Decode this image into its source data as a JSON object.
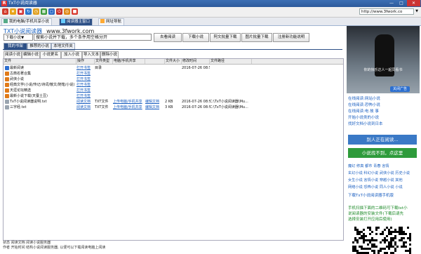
{
  "window": {
    "title": "TxT小说阅读器",
    "controls": {
      "minimize": "—",
      "maximize": "□",
      "close": "✕"
    }
  },
  "toolbar": {
    "icons": [
      {
        "name": "home-icon",
        "color": "#d23b2b",
        "glyph": "⌂"
      },
      {
        "name": "star-icon",
        "color": "#e8a317",
        "glyph": "★"
      },
      {
        "name": "bag-icon",
        "color": "#d4302f",
        "glyph": "▣"
      },
      {
        "name": "refresh-icon",
        "color": "#2f7ad0",
        "glyph": "↻"
      },
      {
        "name": "clock-icon",
        "color": "#e0a020",
        "glyph": "◷"
      },
      {
        "name": "grid-icon",
        "color": "#3a9a3a",
        "glyph": "▦"
      },
      {
        "name": "window-icon",
        "color": "#2c6bc6",
        "glyph": "▢"
      },
      {
        "name": "power-icon",
        "color": "#c8302b",
        "glyph": "⏻"
      },
      {
        "name": "disc-icon",
        "color": "#e08a18",
        "glyph": "◎"
      },
      {
        "name": "stop-icon",
        "color": "#d83a2e",
        "glyph": "■"
      }
    ],
    "address": "http://www.3fwork.co",
    "address_arrow": "▼"
  },
  "window_tabs": [
    {
      "label": "我的电脑/手机共享小说",
      "active": false
    },
    {
      "label": "阅读器主窗口",
      "active": true
    },
    {
      "label": "网址导航",
      "active": false
    }
  ],
  "header": {
    "brand": "TXT小说阅读器",
    "brand_url": "www.3fwork.com",
    "search_category": "下载小说▼",
    "search_text": "搜索小说并下载，多个条件用空格分开",
    "buttons": [
      "去看阅读",
      "下载小说",
      "阿文批量下载",
      "图片批量下载",
      "注册新功能说明"
    ]
  },
  "local_tabs": [
    {
      "label": "我的书架",
      "active": true
    },
    {
      "label": "推荐的小说",
      "active": false
    },
    {
      "label": "本地文件夹",
      "active": false
    }
  ],
  "sub_toolbar": [
    "阅读小说",
    "编辑小说",
    "小说更名",
    "加入小说",
    "导入文本",
    "删除小说"
  ],
  "table": {
    "columns": [
      "文件",
      "操作",
      "文件类型",
      "电脑/手机共享",
      "",
      "文件大小",
      "修改时间",
      "文件路径"
    ],
    "rows": [
      {
        "icon": "#2f6fd0",
        "name": "最新阅读",
        "action": "打开书签",
        "type": "目录",
        "share": "",
        "edit": "",
        "size": "",
        "time": "2016-07-26 08:50",
        "path": ""
      },
      {
        "icon": "#e07a1a",
        "name": "古典名著合集",
        "action": "打开书签",
        "type": "",
        "share": "",
        "edit": "",
        "size": "",
        "time": "",
        "path": ""
      },
      {
        "icon": "#e07a1a",
        "name": "武侠小说",
        "action": "打开书签",
        "type": "",
        "share": "",
        "edit": "",
        "size": "",
        "time": "",
        "path": ""
      },
      {
        "icon": "#e07a1a",
        "name": "经典文学(小说/传记/诗词/散文/随笔/小说)",
        "action": "打开书签",
        "type": "",
        "share": "",
        "edit": "",
        "size": "",
        "time": "",
        "path": ""
      },
      {
        "icon": "#e07a1a",
        "name": "天涯论坛精选",
        "action": "打开书签",
        "type": "",
        "share": "",
        "edit": "",
        "size": "",
        "time": "",
        "path": ""
      },
      {
        "icon": "#e07a1a",
        "name": "最新小说下载(天蚕土豆)",
        "action": "打开书签",
        "type": "",
        "share": "",
        "edit": "",
        "size": "",
        "time": "",
        "path": ""
      },
      {
        "icon": "#9aa4b0",
        "name": "TxT小说阅读器说明.txt",
        "action": "阅读文档",
        "type": "TXT文件",
        "share": "上传电脑/手机共享",
        "edit": "编辑文档",
        "size": "2 KB",
        "time": "2016-07-26 08:50",
        "path": "C:\\TxT小说阅读器\\Mu..."
      },
      {
        "icon": "#9aa4b0",
        "name": "三字经.txt",
        "action": "阅读文档",
        "type": "TXT文件",
        "share": "上传电脑/手机共享",
        "edit": "编辑文档",
        "size": "3 KB",
        "time": "2016-07-26 08:50",
        "path": "C:\\TxT小说阅读器\\Mu..."
      }
    ]
  },
  "status": {
    "line1": "状态 阅读文档 阅读小说服务器",
    "line2": "作者 开始时间 结构小说阅读服务器, 以便可以下载阅读电脑上阅读"
  },
  "right_panel": {
    "promo_text": "你的快乐达人一起同看书",
    "close_ad": "关闭广告",
    "links": [
      "在线阅读:网站小说",
      "在线阅读:恐怖小说",
      "在线阅读:电 故 事",
      "开始小说类的小说",
      "找好文档小说到日本"
    ],
    "reading_button": "别人正在阅读...",
    "reading_button_color": "#3a79c6",
    "find_button": "小说找不到，点这里",
    "find_button_color": "#2e9b3b",
    "categories": [
      [
        "魔幻",
        "修真",
        "都市",
        "青春",
        "言情"
      ],
      [
        "玄幻小说",
        "科幻小说",
        "武侠小说",
        "历史小说"
      ],
      [
        "女生小说",
        "言情小说",
        "穿越小说",
        "其他"
      ],
      [
        "网络小说",
        "恐怖小说",
        "同人小说",
        "小说"
      ]
    ],
    "download_link": "下载TxT小说阅读器手机版",
    "download_text": [
      "手机扫描下面的二维码可下载txt小",
      "说阅读器的安装文件(下载后请先",
      "选择安装打开应用后使用)"
    ]
  }
}
